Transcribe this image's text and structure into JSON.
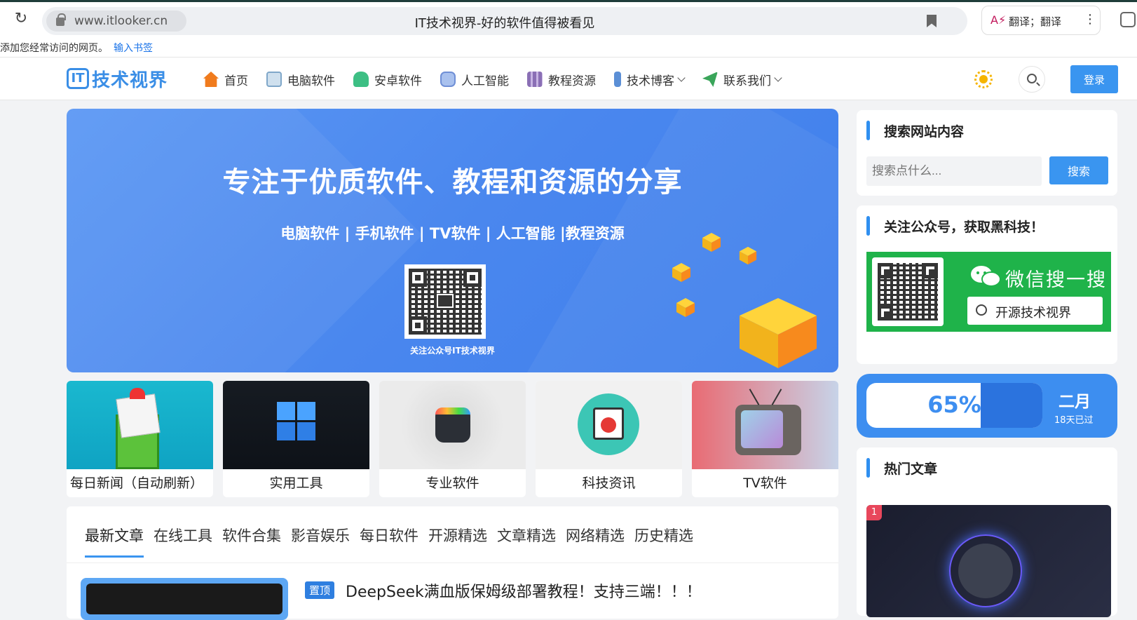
{
  "browser": {
    "url": "www.itlooker.cn",
    "tab_title": "IT技术视界-好的软件值得被看见",
    "translate_label": "翻译；翻译",
    "translate_icon": "translate-icon",
    "bookmark_hint": "添加您经常访问的网页。",
    "bookmark_link": "输入书签"
  },
  "site": {
    "logo_box": "IT",
    "logo_text": "技术视界",
    "nav": [
      {
        "label": "首页",
        "icon": "home-icon",
        "color": "#f07b1d"
      },
      {
        "label": "电脑软件",
        "icon": "pc-software-icon",
        "color": "#7fa7c9"
      },
      {
        "label": "安卓软件",
        "icon": "android-icon",
        "color": "#3dbf84"
      },
      {
        "label": "人工智能",
        "icon": "robot-icon",
        "color": "#6f8fd6"
      },
      {
        "label": "教程资源",
        "icon": "books-icon",
        "color": "#8a6fb5"
      },
      {
        "label": "技术博客",
        "icon": "pencil-icon",
        "color": "#5b8fd6"
      },
      {
        "label": "联系我们",
        "icon": "paper-plane-icon",
        "color": "#3aa55a"
      }
    ],
    "login_label": "登录"
  },
  "hero": {
    "title": "专注于优质软件、教程和资源的分享",
    "subtitle": "电脑软件 | 手机软件 | TV软件 | 人工智能 |教程资源",
    "qr_caption": "关注公众号IT技术视界"
  },
  "cards": [
    {
      "label": "每日新闻（自动刷新）"
    },
    {
      "label": "实用工具"
    },
    {
      "label": "专业软件"
    },
    {
      "label": "科技资讯"
    },
    {
      "label": "TV软件"
    }
  ],
  "articles": {
    "tabs": [
      "最新文章",
      "在线工具",
      "软件合集",
      "影音娱乐",
      "每日软件",
      "开源精选",
      "文章精选",
      "网络精选",
      "历史精选"
    ],
    "active_tab": 0,
    "pin_badge": "置顶",
    "first_title": "DeepSeek满血版保姆级部署教程！支持三端！！！"
  },
  "sidebar": {
    "search_title": "搜索网站内容",
    "search_placeholder": "搜索点什么...",
    "search_button": "搜索",
    "wx_title": "关注公众号，获取黑科技！",
    "wx_banner_title": "微信搜一搜",
    "wx_search_text": "开源技术视界",
    "progress_percent": "65%",
    "progress_value": 0.65,
    "month_label": "二月",
    "days_label": "18天已过",
    "hot_title": "热门文章",
    "hot_rank": "1"
  },
  "colors": {
    "accent": "#3a95f0",
    "hero_blue": "#4a87ee",
    "wechat_green": "#1fb34a"
  }
}
